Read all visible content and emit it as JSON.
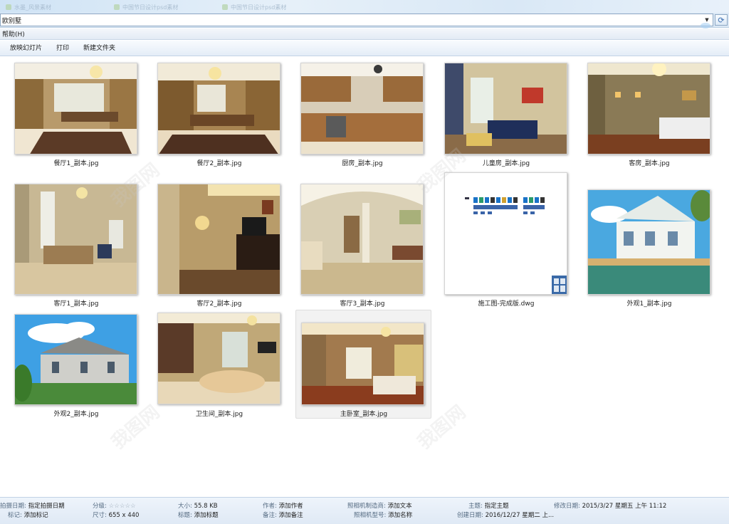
{
  "browser": {
    "tabs": [
      {
        "label": "水墨_风景素材"
      },
      {
        "label": "中国节日设计psd素材"
      },
      {
        "label": "中国节日设计psd素材"
      }
    ],
    "address": "欧别墅"
  },
  "menu": {
    "help": "帮助(H)"
  },
  "toolbar": {
    "slideshow": "放映幻灯片",
    "print": "打印",
    "new_folder": "新建文件夹"
  },
  "files": [
    {
      "name": "餐厅1_副本.jpg",
      "icon": "image-thumbnail"
    },
    {
      "name": "餐厅2_副本.jpg",
      "icon": "image-thumbnail"
    },
    {
      "name": "厨房_副本.jpg",
      "icon": "image-thumbnail"
    },
    {
      "name": "儿童房_副本.jpg",
      "icon": "image-thumbnail"
    },
    {
      "name": "客房_副本.jpg",
      "icon": "image-thumbnail"
    },
    {
      "name": "客厅1_副本.jpg",
      "icon": "image-thumbnail"
    },
    {
      "name": "客厅2_副本.jpg",
      "icon": "image-thumbnail"
    },
    {
      "name": "客厅3_副本.jpg",
      "icon": "image-thumbnail"
    },
    {
      "name": "施工图-完成版.dwg",
      "icon": "dwg-file-icon"
    },
    {
      "name": "外观1_副本.jpg",
      "icon": "image-thumbnail"
    },
    {
      "name": "外观2_副本.jpg",
      "icon": "image-thumbnail"
    },
    {
      "name": "卫生间_副本.jpg",
      "icon": "image-thumbnail"
    },
    {
      "name": "主卧室_副本.jpg",
      "icon": "image-thumbnail",
      "selected": true
    }
  ],
  "details": {
    "shot_date_label": "拍摄日期:",
    "shot_date_value": "指定拍摄日期",
    "tag_label": "标记:",
    "tag_value": "添加标记",
    "rating_label": "分级:",
    "rating_stars": "☆☆☆☆☆",
    "dimensions_label": "尺寸:",
    "dimensions_value": "655 x 440",
    "size_label": "大小:",
    "size_value": "55.8 KB",
    "title_label": "标题:",
    "title_value": "添加标题",
    "author_label": "作者:",
    "author_value": "添加作者",
    "comment_label": "备注:",
    "comment_value": "添加备注",
    "maker_label": "照相机制造商:",
    "maker_value": "添加文本",
    "model_label": "照相机型号:",
    "model_value": "添加名称",
    "subject_label": "主题:",
    "subject_value": "指定主题",
    "created_label": "创建日期:",
    "created_value": "2016/12/27 星期二 上...",
    "modified_label": "修改日期:",
    "modified_value": "2015/3/27 星期五 上午 11:12"
  },
  "colors": {
    "selection": "#f2f2f2",
    "chrome": "#dfe9f5",
    "accent": "#3c6fb0"
  }
}
